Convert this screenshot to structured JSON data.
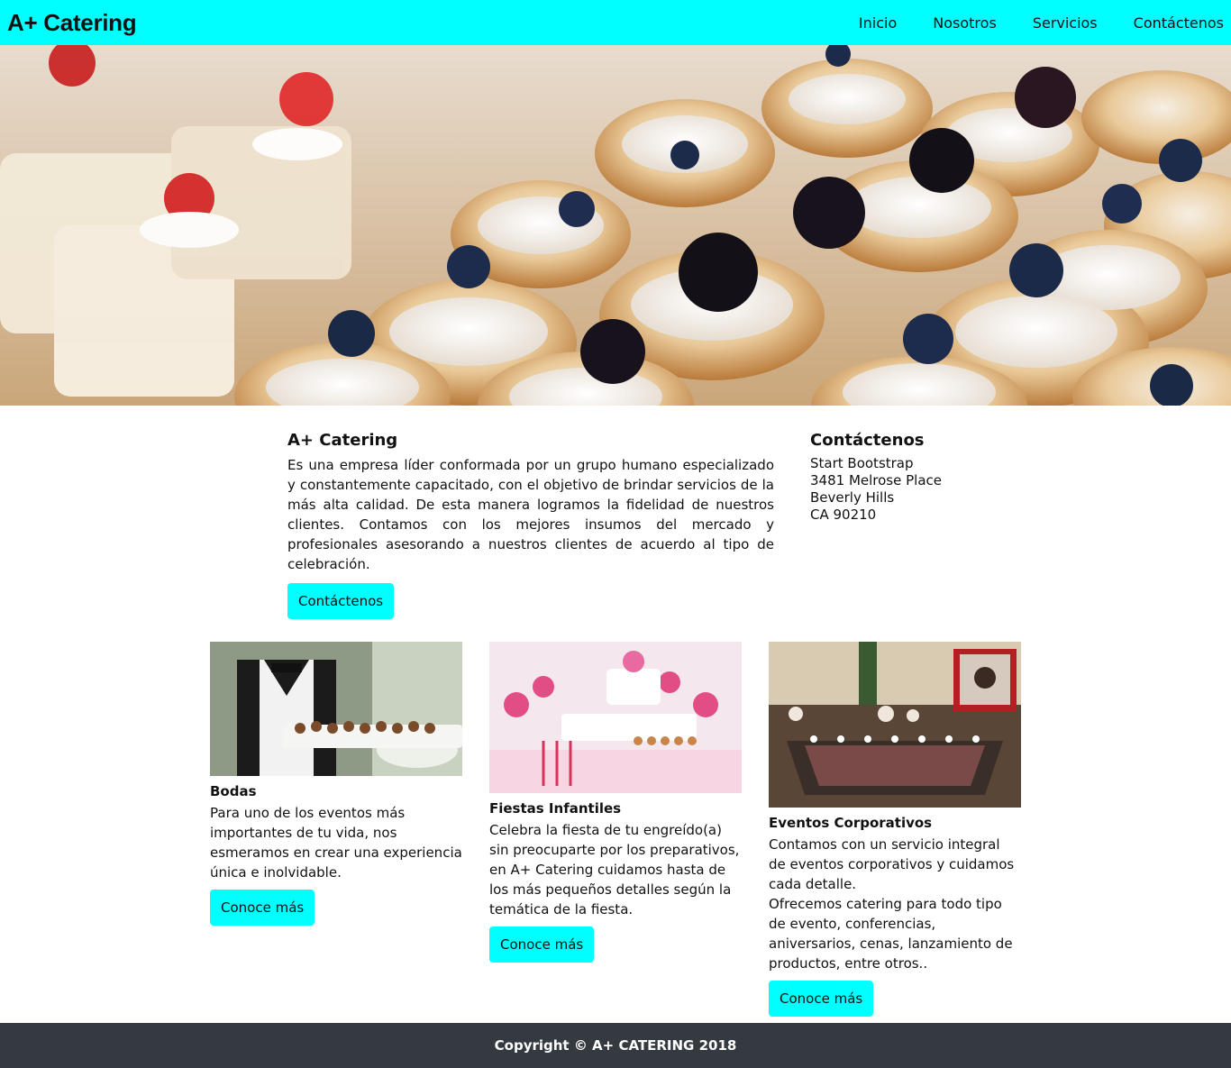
{
  "navbar": {
    "brand": "A+ Catering",
    "links": [
      "Inicio",
      "Nosotros",
      "Servicios",
      "Contáctenos"
    ]
  },
  "hero": {
    "image": "dessert-tarts-with-blueberries-and-blackberries"
  },
  "about": {
    "title": "A+ Catering",
    "text": "Es una empresa líder conformada por un grupo humano especializado y constantemente capacitado, con el objetivo de brindar servicios de la más alta calidad. De esta manera logramos la fidelidad de nuestros clientes. Contamos con los mejores insumos del mercado y profesionales asesorando a nuestros clientes de acuerdo al tipo de celebración.",
    "button": "Contáctenos"
  },
  "contact": {
    "title": "Contáctenos",
    "lines": [
      "Start Bootstrap",
      "3481 Melrose Place",
      "Beverly Hills",
      "CA 90210"
    ]
  },
  "cards": [
    {
      "image": "waiter-serving-tray",
      "title": "Bodas",
      "text": "Para uno de los eventos más importantes de tu vida, nos esmeramos en crear una experiencia única e inolvidable.",
      "button": "Conoce más"
    },
    {
      "image": "pink-kids-party-dessert-table",
      "title": "Fiestas Infantiles",
      "text": "Celebra la fiesta de tu engreído(a) sin preocuparte por los preparativos, en A+ Catering cuidamos hasta de los más pequeños detalles según la temática de la fiesta.",
      "button": "Conoce más"
    },
    {
      "image": "corporate-banquet-hall",
      "title": "Eventos Corporativos",
      "text": "Contamos con un servicio integral de eventos corporativos y cuidamos cada detalle.",
      "text2": "Ofrecemos catering para todo tipo de evento, conferencias, aniversarios, cenas, lanzamiento de productos, entre otros..",
      "button": "Conoce más"
    }
  ],
  "footer": {
    "text": "Copyright © A+ CATERING 2018"
  },
  "colors": {
    "accent": "#00ffff",
    "footer": "#343a40"
  }
}
